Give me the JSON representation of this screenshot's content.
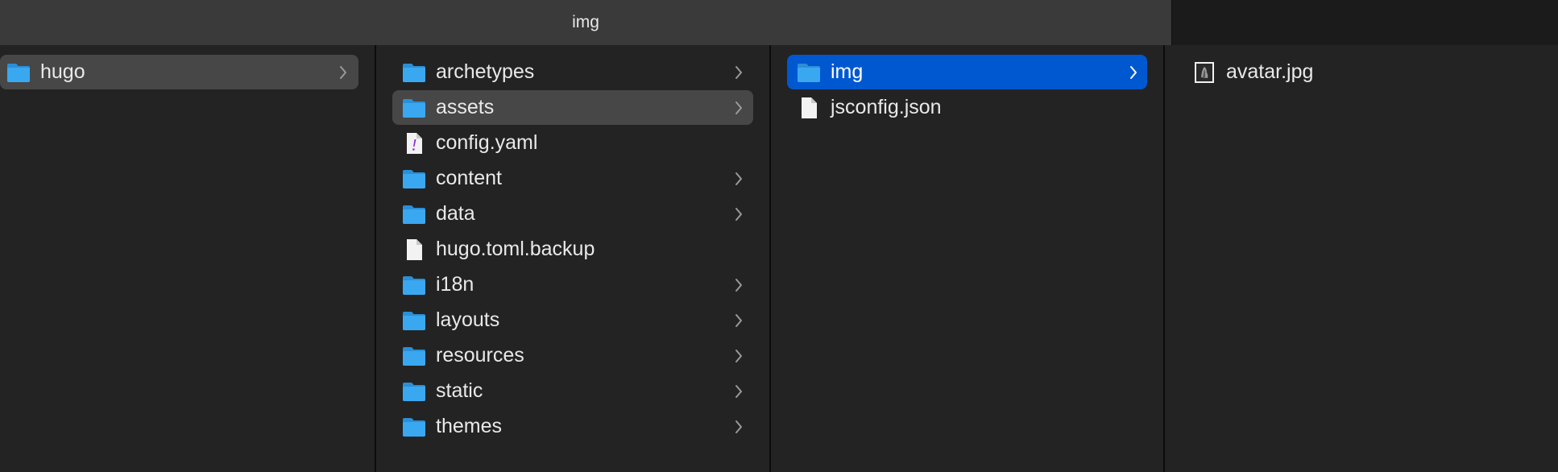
{
  "window": {
    "tab_title": "img"
  },
  "columns": [
    {
      "items": [
        {
          "label": "hugo",
          "kind": "folder",
          "state": "selected-inactive",
          "has_children": true
        }
      ]
    },
    {
      "items": [
        {
          "label": "archetypes",
          "kind": "folder",
          "state": "",
          "has_children": true
        },
        {
          "label": "assets",
          "kind": "folder",
          "state": "selected-inactive",
          "has_children": true
        },
        {
          "label": "config.yaml",
          "kind": "yaml",
          "state": "",
          "has_children": false
        },
        {
          "label": "content",
          "kind": "folder",
          "state": "",
          "has_children": true
        },
        {
          "label": "data",
          "kind": "folder",
          "state": "",
          "has_children": true
        },
        {
          "label": "hugo.toml.backup",
          "kind": "file",
          "state": "",
          "has_children": false
        },
        {
          "label": "i18n",
          "kind": "folder",
          "state": "",
          "has_children": true
        },
        {
          "label": "layouts",
          "kind": "folder",
          "state": "",
          "has_children": true
        },
        {
          "label": "resources",
          "kind": "folder",
          "state": "",
          "has_children": true
        },
        {
          "label": "static",
          "kind": "folder",
          "state": "",
          "has_children": true
        },
        {
          "label": "themes",
          "kind": "folder",
          "state": "",
          "has_children": true
        }
      ]
    },
    {
      "items": [
        {
          "label": "img",
          "kind": "folder",
          "state": "selected-active",
          "has_children": true
        },
        {
          "label": "jsconfig.json",
          "kind": "file",
          "state": "",
          "has_children": false
        }
      ]
    },
    {
      "items": [
        {
          "label": "avatar.jpg",
          "kind": "image",
          "state": "",
          "has_children": false
        }
      ]
    }
  ],
  "colors": {
    "selection_active": "#0058d0",
    "selection_inactive": "#474747",
    "folder_blue": "#3aa8f0"
  }
}
